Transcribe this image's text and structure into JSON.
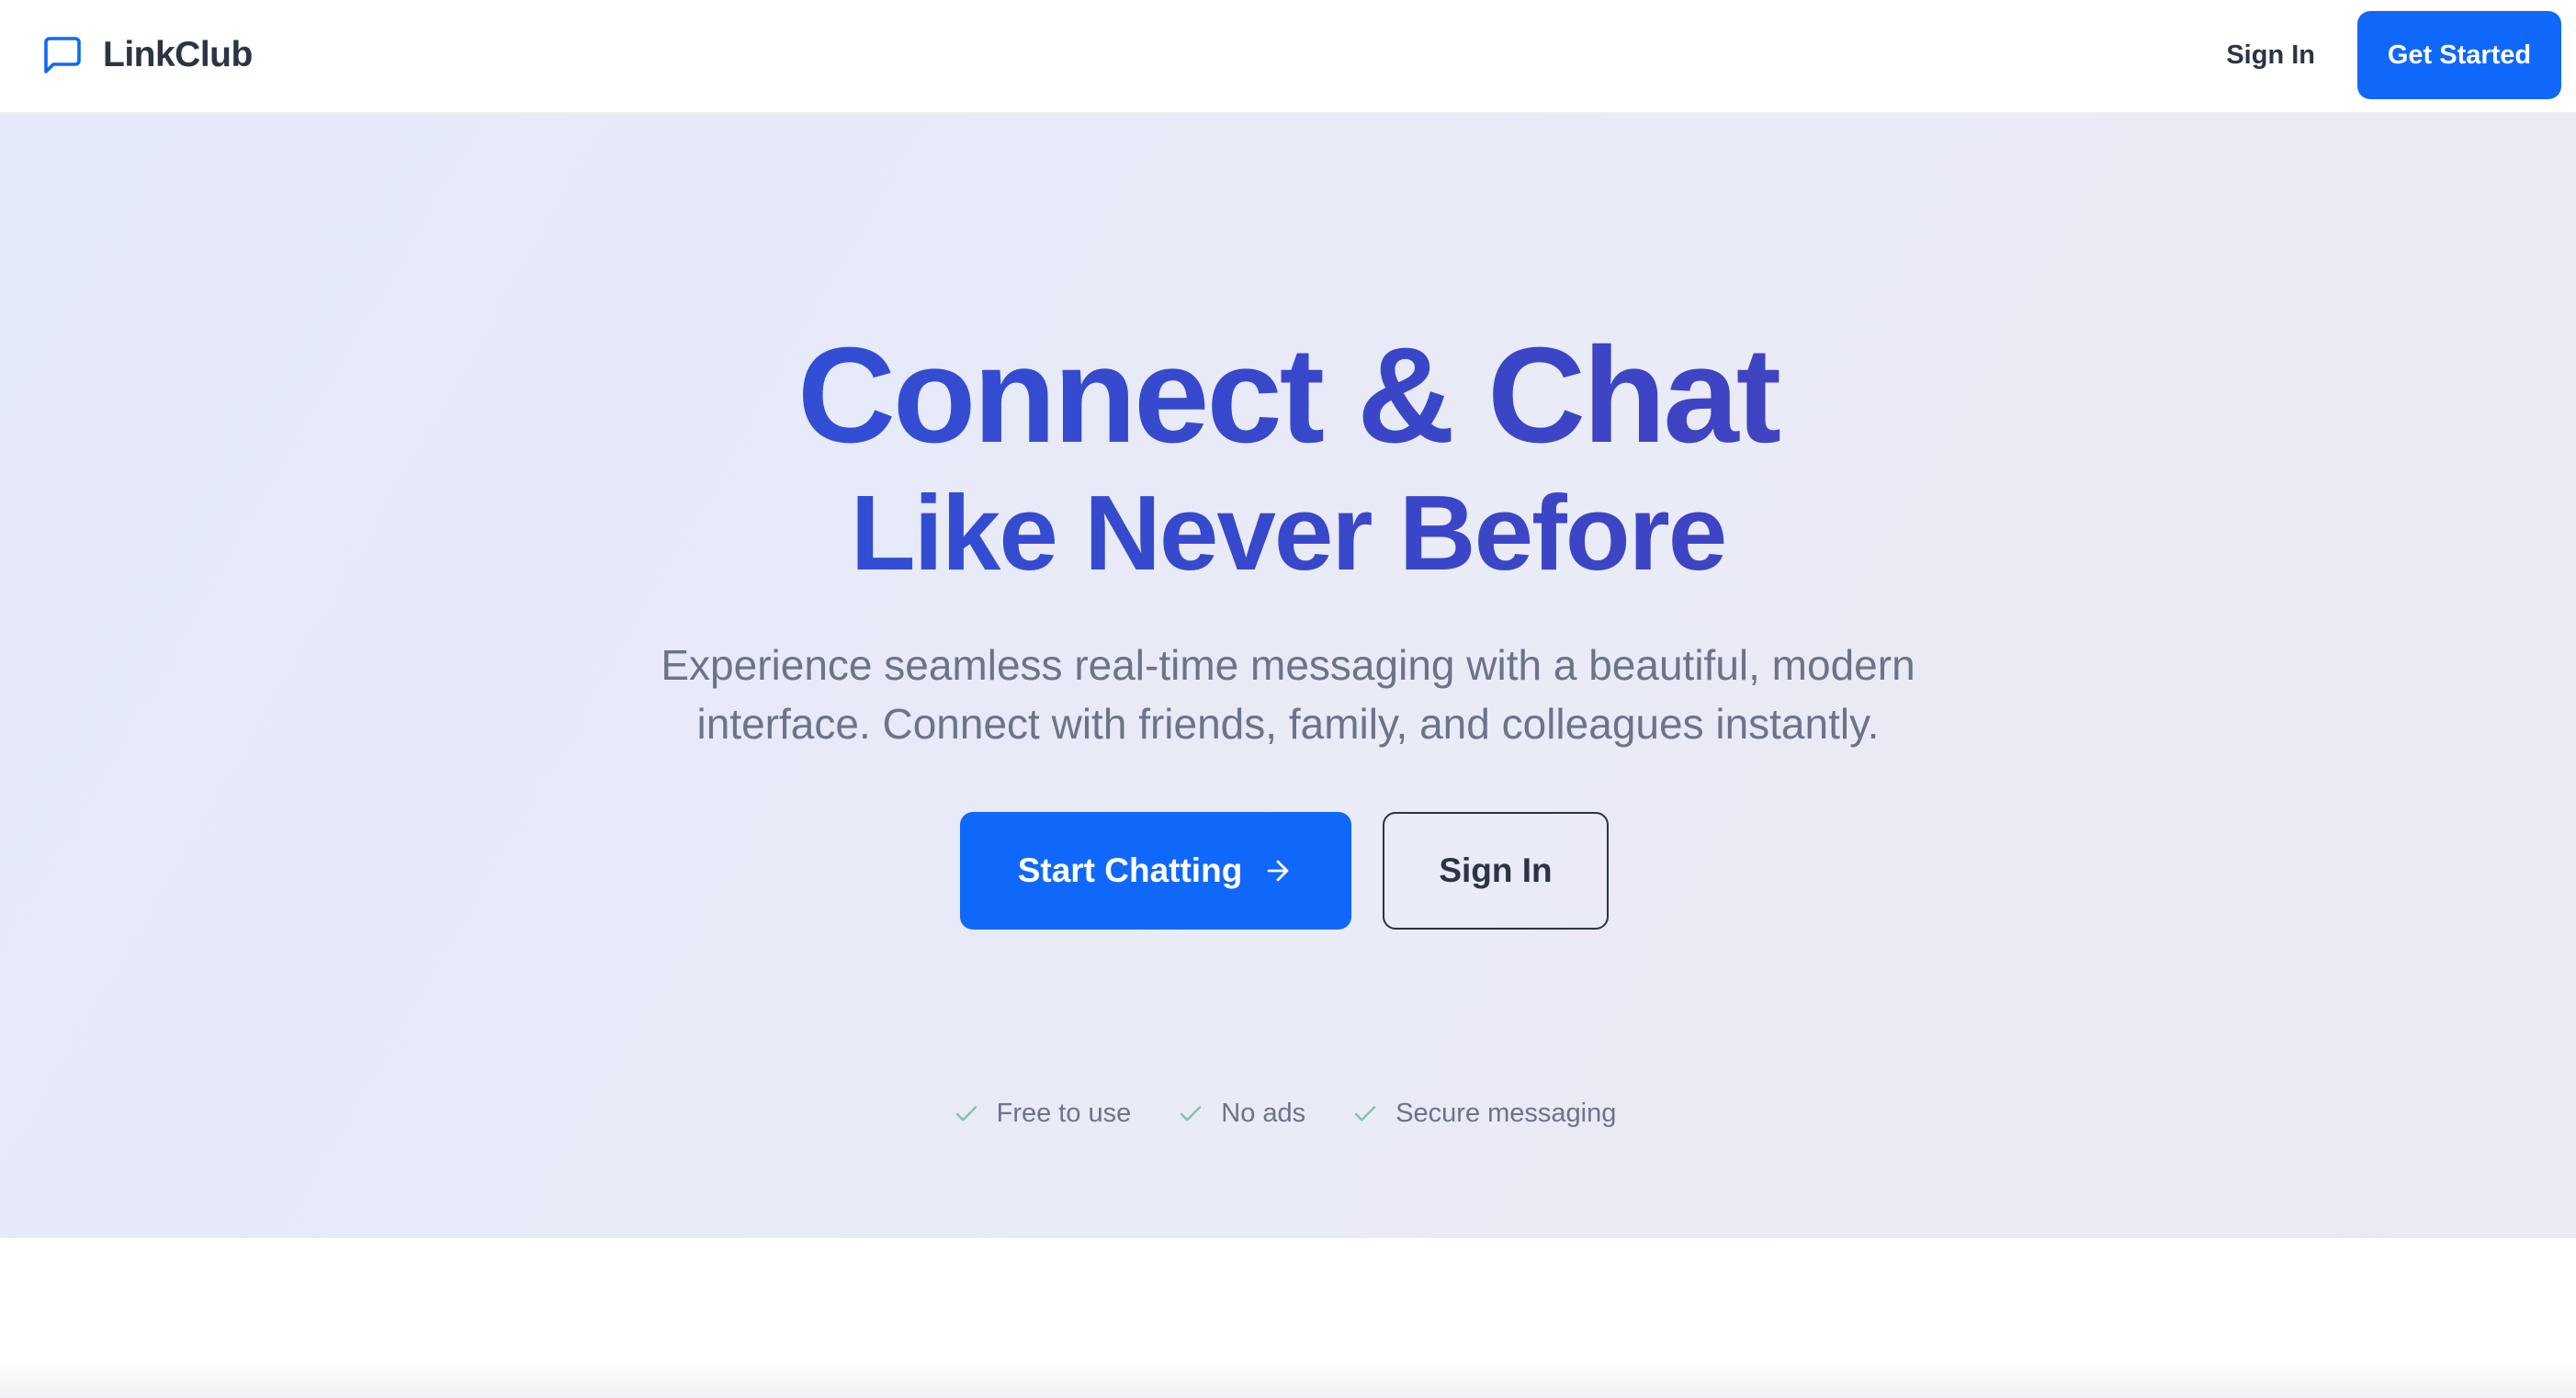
{
  "header": {
    "brand_name": "LinkClub",
    "brand_icon": "message-square-icon",
    "nav_signin_label": "Sign In",
    "nav_cta_label": "Get Started"
  },
  "hero": {
    "title_line_1": "Connect & Chat",
    "title_line_2": "Like Never Before",
    "subtitle": "Experience seamless real-time messaging with a beautiful, modern interface. Connect with friends, family, and colleagues instantly.",
    "primary_button_label": "Start Chatting",
    "primary_button_icon": "arrow-right-icon",
    "secondary_button_label": "Sign In",
    "features": [
      {
        "label": "Free to use",
        "icon": "check-icon"
      },
      {
        "label": "No ads",
        "icon": "check-icon"
      },
      {
        "label": "Secure messaging",
        "icon": "check-icon"
      }
    ]
  },
  "colors": {
    "brand_blue": "#1068fa",
    "title_gradient_start": "#2659e6",
    "title_gradient_end": "#4a3fb4",
    "check_green": "#7fc7a8",
    "text_dark": "#2b3445",
    "text_muted": "#6b7488"
  }
}
